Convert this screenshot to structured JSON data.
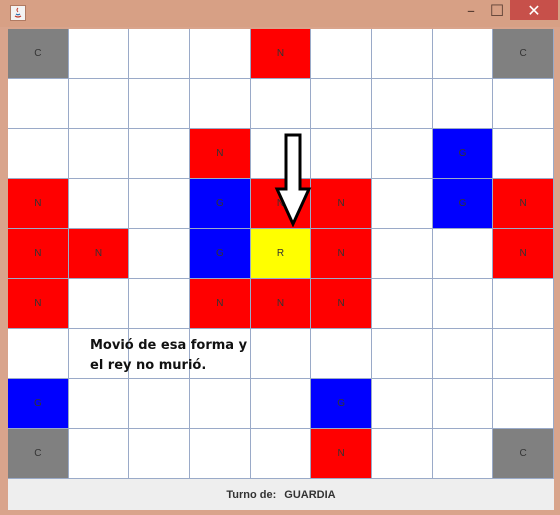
{
  "window": {
    "minimize_glyph": "–",
    "maximize_glyph": "☐",
    "close_glyph": "✕"
  },
  "colors": {
    "N": "#ff0000",
    "G": "#0000ff",
    "R": "#ffff00",
    "C": "#808080",
    "": "#ffffff"
  },
  "board": [
    [
      "C",
      "",
      "",
      "",
      "N",
      "",
      "",
      "",
      "C"
    ],
    [
      "",
      "",
      "",
      "",
      "",
      "",
      "",
      "",
      ""
    ],
    [
      "",
      "",
      "",
      "N",
      "",
      "",
      "",
      "G",
      ""
    ],
    [
      "N",
      "",
      "",
      "G",
      "N",
      "N",
      "",
      "G",
      "N"
    ],
    [
      "N",
      "N",
      "",
      "G",
      "R",
      "N",
      "",
      "",
      "N"
    ],
    [
      "N",
      "",
      "",
      "N",
      "N",
      "N",
      "",
      "",
      ""
    ],
    [
      "",
      "",
      "",
      "",
      "",
      "",
      "",
      "",
      ""
    ],
    [
      "G",
      "",
      "",
      "",
      "",
      "G",
      "",
      "",
      ""
    ],
    [
      "C",
      "",
      "",
      "",
      "",
      "N",
      "",
      "",
      "C"
    ]
  ],
  "annotation": {
    "line1": "Movió de esa forma y",
    "line2": "el rey no murió."
  },
  "status": {
    "label": "Turno de:",
    "value": "GUARDIA"
  }
}
